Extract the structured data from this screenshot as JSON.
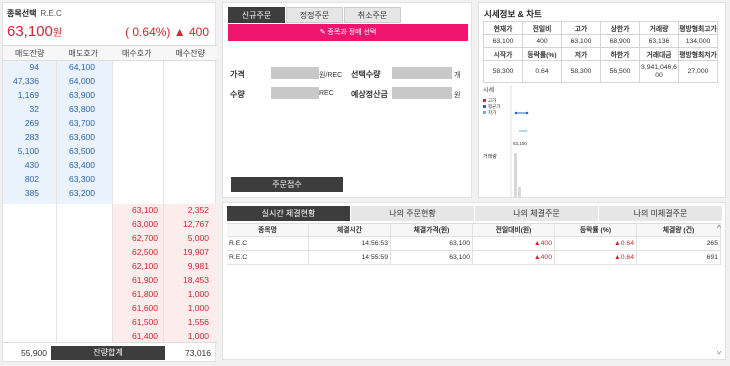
{
  "orderbook": {
    "symbol_label": "종목선택",
    "symbol_name": "R.E.C",
    "price": "63,100",
    "price_unit": "원",
    "change_pct": "( 0.64%)",
    "change_val": "▲ 400",
    "headers": [
      "매도잔량",
      "매도호가",
      "매수호가",
      "매수잔량"
    ],
    "asks": [
      {
        "qty": "94",
        "price": "64,100"
      },
      {
        "qty": "47,336",
        "price": "64,000"
      },
      {
        "qty": "1,169",
        "price": "63,900"
      },
      {
        "qty": "32",
        "price": "63,800"
      },
      {
        "qty": "269",
        "price": "63,700"
      },
      {
        "qty": "283",
        "price": "63,600"
      },
      {
        "qty": "5,100",
        "price": "63,500"
      },
      {
        "qty": "430",
        "price": "63,400"
      },
      {
        "qty": "802",
        "price": "63,300"
      },
      {
        "qty": "385",
        "price": "63,200"
      }
    ],
    "bids": [
      {
        "price": "63,100",
        "qty": "2,352"
      },
      {
        "price": "63,000",
        "qty": "12,767"
      },
      {
        "price": "62,700",
        "qty": "5,000"
      },
      {
        "price": "62,500",
        "qty": "19,907"
      },
      {
        "price": "62,100",
        "qty": "9,981"
      },
      {
        "price": "61,900",
        "qty": "18,453"
      },
      {
        "price": "61,800",
        "qty": "1,000"
      },
      {
        "price": "61,600",
        "qty": "1,000"
      },
      {
        "price": "61,500",
        "qty": "1,556"
      },
      {
        "price": "61,400",
        "qty": "1,000"
      }
    ],
    "total_ask": "55,900",
    "total_label": "잔량합계",
    "total_bid": "73,016"
  },
  "order_form": {
    "tabs": [
      "신규주문",
      "정정주문",
      "취소주문"
    ],
    "select_button": "종목과 정매 선택",
    "price_label": "가격",
    "price_unit": "원/REC",
    "qty_label": "수량",
    "qty_unit": "REC",
    "select_qty_label": "선택수량",
    "select_qty_unit": "개",
    "expected_label": "예상정산금",
    "expected_unit": "원",
    "submit_label": "주문접수"
  },
  "market_info": {
    "title": "시세정보 & 차트",
    "row1_headers": [
      "현재가",
      "전일비",
      "고가",
      "상한가",
      "거래량",
      "평방형최고가"
    ],
    "row1_values": [
      "63,100",
      "400",
      "63,100",
      "68,900",
      "63,136",
      "134,000"
    ],
    "row2_headers": [
      "시작가",
      "등락률(%)",
      "저가",
      "하한가",
      "거래대금",
      "평방형최저가"
    ],
    "row2_values": [
      "58,300",
      "0.64",
      "58,300",
      "56,500",
      "3,941,046,600",
      "27,000"
    ],
    "chart_label_price": "시세",
    "chart_label_volume": "거래량",
    "legend": [
      "고가",
      "평균가",
      "저가"
    ],
    "chart_value": "63,100",
    "colors": {
      "high": "#d9232e",
      "avg": "#2f66b3",
      "low": "#5bb7e6"
    }
  },
  "trades": {
    "tabs": [
      "실시간 체결현황",
      "나의 주문현황",
      "나의 체결주문",
      "나의 미체결주문"
    ],
    "headers": [
      "종목명",
      "체결시간",
      "체결가격(원)",
      "전일대비(원)",
      "등락률 (%)",
      "체결량 (건)"
    ],
    "rows": [
      {
        "name": "R.E.C",
        "time": "14:56:53",
        "price": "63,100",
        "diff": "▲400",
        "rate": "▲0.64",
        "vol": "265"
      },
      {
        "name": "R.E.C",
        "time": "14:55:59",
        "price": "63,100",
        "diff": "▲400",
        "rate": "▲0.64",
        "vol": "691"
      }
    ]
  }
}
